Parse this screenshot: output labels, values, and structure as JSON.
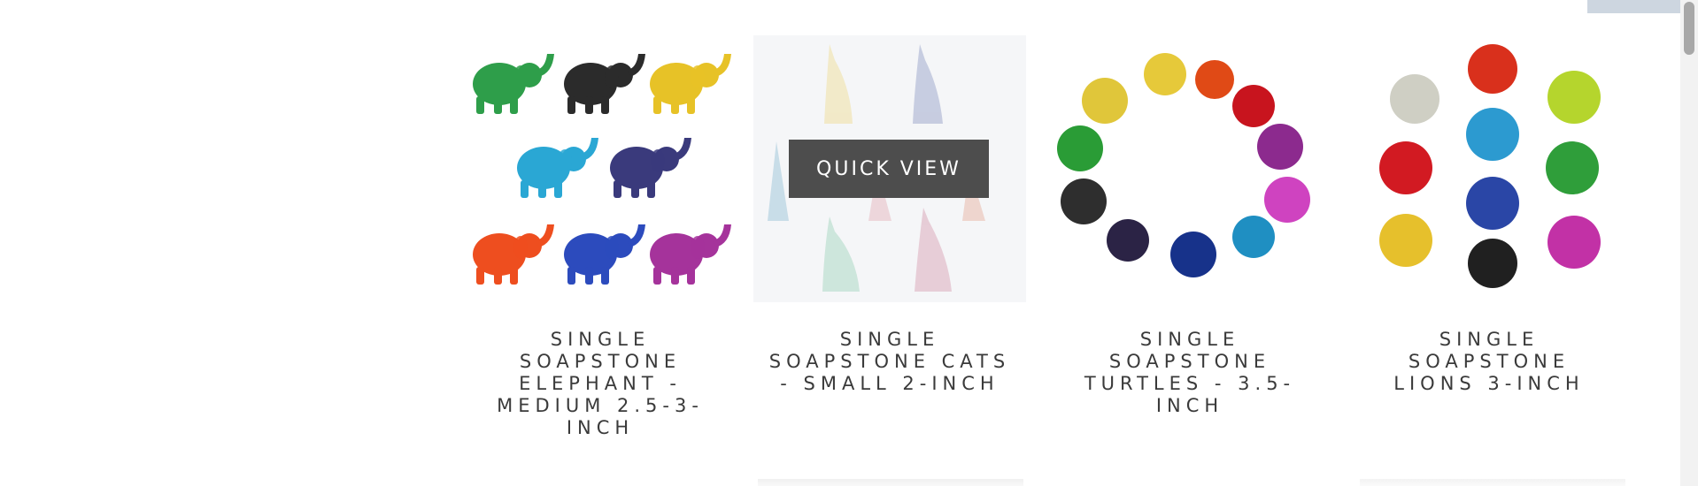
{
  "products": [
    {
      "title": "SINGLE SOAPSTONE ELEPHANT - MEDIUM 2.5-3-INCH",
      "image": "soapstone-elephants-image"
    },
    {
      "title": "SINGLE SOAPSTONE CATS - SMALL 2-INCH",
      "image": "soapstone-cats-image",
      "quick_view_label": "QUICK VIEW"
    },
    {
      "title": "SINGLE SOAPSTONE TURTLES - 3.5-INCH",
      "image": "soapstone-turtles-image"
    },
    {
      "title": "SINGLE SOAPSTONE LIONS 3-INCH",
      "image": "soapstone-lions-image"
    }
  ],
  "colors": {
    "title_text": "#3a3a3a",
    "quick_view_bg": "#4d4d4d",
    "hover_bg": "#f5f6f8"
  }
}
